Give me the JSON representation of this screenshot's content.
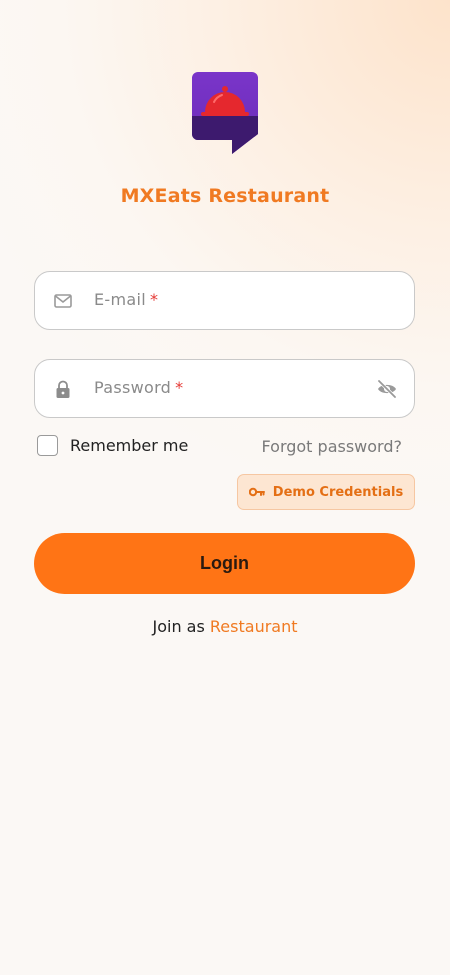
{
  "brand": {
    "name": "MXEats Restaurant",
    "accent": "#f07a22",
    "primary": "#ff7415"
  },
  "email": {
    "placeholder": "E-mail",
    "required_mark": "*",
    "icon": "mail-icon"
  },
  "password": {
    "placeholder": "Password",
    "required_mark": "*",
    "icon": "lock-icon",
    "toggle_icon": "eye-off-icon"
  },
  "remember": {
    "label": "Remember me",
    "checked": false
  },
  "forgot": {
    "label": "Forgot password?"
  },
  "demo": {
    "label": "Demo Credentials",
    "icon": "key-icon"
  },
  "login": {
    "label": "Login"
  },
  "join": {
    "prefix": "Join as",
    "link": "Restaurant"
  }
}
